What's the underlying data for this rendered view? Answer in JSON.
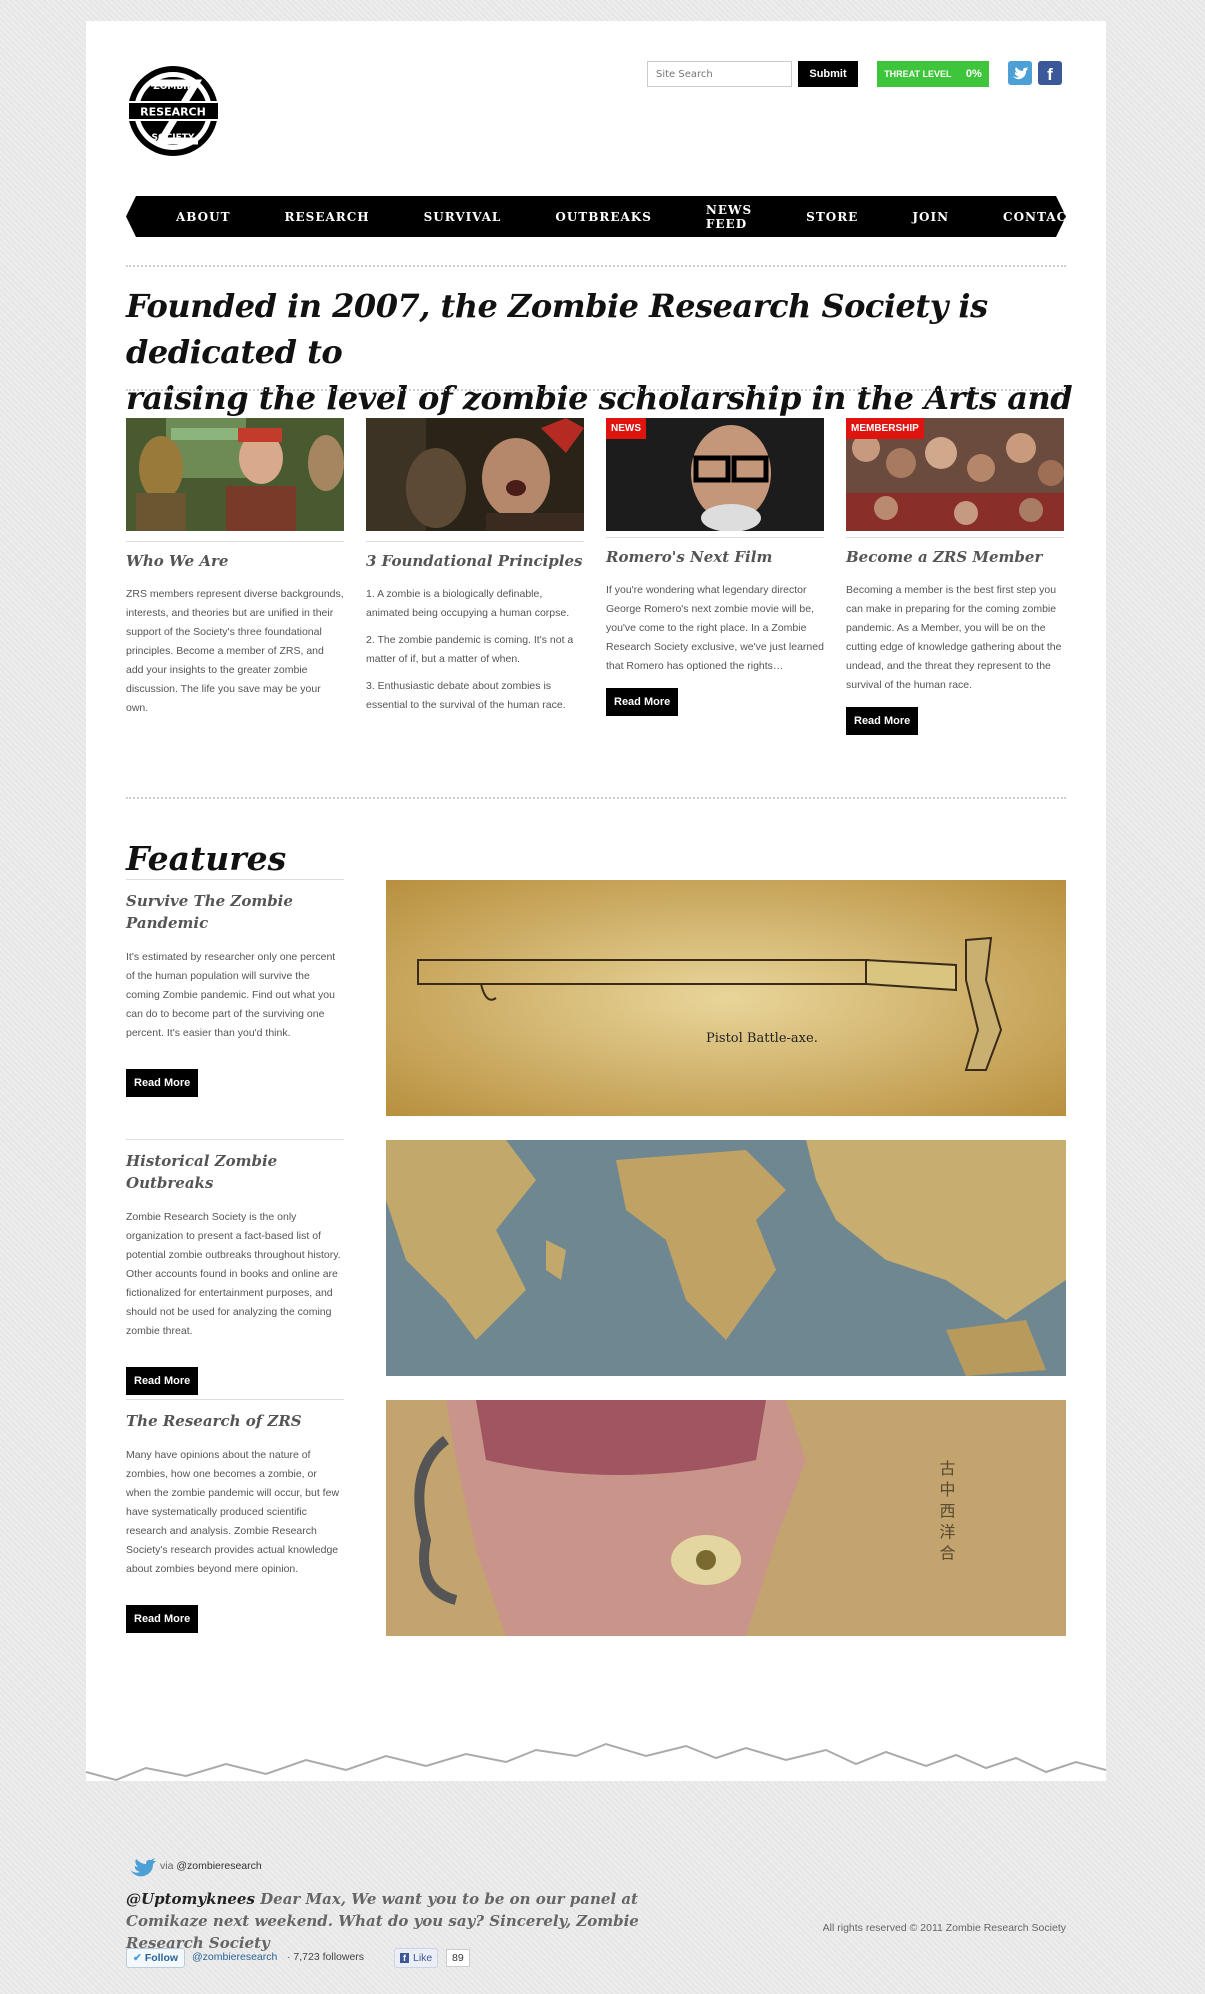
{
  "header": {
    "logo_text": [
      "ZOMBIE",
      "RESEARCH",
      "SOCIETY"
    ],
    "search_placeholder": "Site Search",
    "search_button": "Submit",
    "threat_label": "THREAT LEVEL",
    "threat_value": "0%",
    "fb_label": "f"
  },
  "nav": [
    "ABOUT",
    "RESEARCH",
    "SURVIVAL",
    "OUTBREAKS",
    "NEWS FEED",
    "STORE",
    "JOIN",
    "CONTACT"
  ],
  "hero": {
    "line1": "Founded in 2007, the Zombie Research Society is dedicated to",
    "line2": "raising the level of zombie scholarship in the Arts and Sciences."
  },
  "cards": [
    {
      "title": "Who We Are",
      "paragraphs": [
        "ZRS members represent diverse backgrounds, interests, and theories but are unified in their support of the Society's three foundational principles. Become a member of ZRS, and add your insights to the greater zombie discussion. The life you save may be your own."
      ]
    },
    {
      "title": "3 Foundational Principles",
      "paragraphs": [
        "1. A zombie is a biologically definable, animated being occupying a human corpse.",
        "2. The zombie pandemic is coming. It's not a matter of if, but a matter of when.",
        "3. Enthusiastic debate about zombies is essential to the survival of the human race."
      ]
    },
    {
      "tag": "NEWS",
      "title": "Romero's Next Film",
      "paragraphs": [
        "If you're wondering what legendary director George Romero's next zombie movie will be, you've come to the right place. In a Zombie Research Society exclusive, we've just learned that Romero has optioned the rights…"
      ],
      "button": "Read More"
    },
    {
      "tag": "MEMBERSHIP",
      "title": "Become a ZRS Member",
      "paragraphs": [
        "Becoming a member is the best first step you can make in preparing for the coming zombie pandemic. As a Member, you will be on the cutting edge of knowledge gathering about the undead, and the threat they represent to the survival of the human race."
      ],
      "button": "Read More"
    }
  ],
  "features": {
    "title": "Features",
    "items": [
      {
        "title": "Survive The Zombie Pandemic",
        "text": "It's estimated by researcher only one percent of the human population will survive the coming Zombie pandemic. Find out what you can do to become part of the surviving one percent. It's easier than you'd think.",
        "button": "Read More",
        "image_caption": "Pistol Battle-axe."
      },
      {
        "title": "Historical Zombie Outbreaks",
        "text": "Zombie Research Society is the only organization to present a fact-based list of potential zombie outbreaks throughout history. Other accounts found in books and online are fictionalized for entertainment purposes, and should not be used for analyzing the coming zombie threat.",
        "button": "Read More"
      },
      {
        "title": "The Research of ZRS",
        "text": "Many have opinions about the nature of zombies, how one becomes a zombie, or when the zombie pandemic will occur, but few have systematically produced scientific research and analysis. Zombie Research Society's research provides actual knowledge about zombies beyond mere opinion.",
        "button": "Read More",
        "image_script": "古 中 西 洋 合"
      }
    ]
  },
  "footer": {
    "via_prefix": "via",
    "via_handle": "@zombieresearch",
    "tweet_user": "@Uptomyknees",
    "tweet_text": " Dear Max, We want you to be on our panel at Comikaze next weekend. What do you say? Sincerely, Zombie Research Society",
    "follow_label": "Follow",
    "follow_handle": "@zombieresearch",
    "followers": "· 7,723 followers",
    "like_label": "Like",
    "like_count": "89",
    "copyright": "All rights reserved © 2011 Zombie Research Society"
  },
  "colors": {
    "threat_green": "#3ec53b",
    "tag_red": "#e0140f",
    "nav_black": "#000000"
  }
}
